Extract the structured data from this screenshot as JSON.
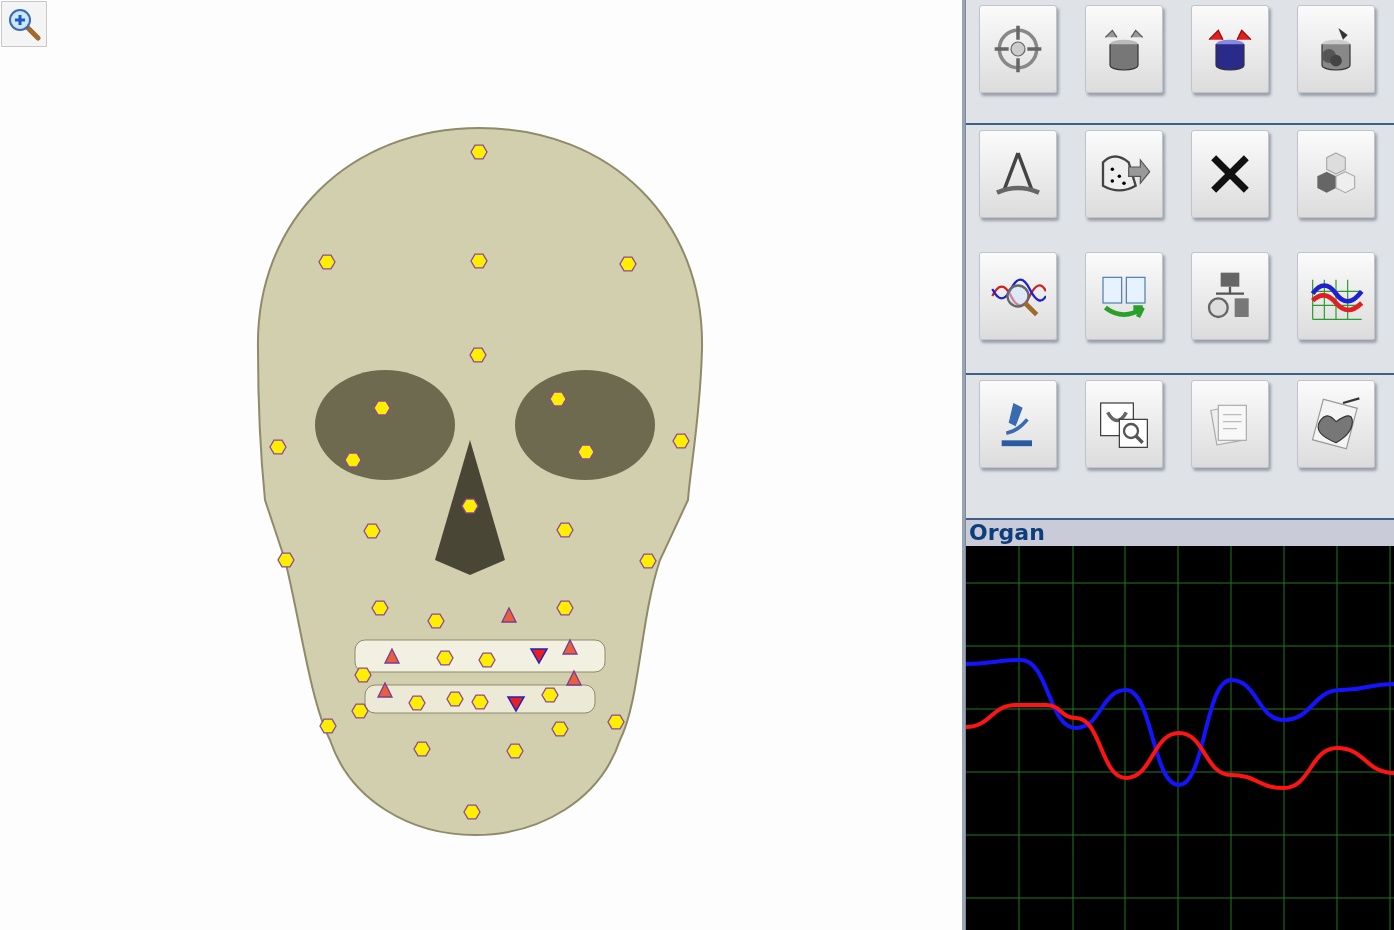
{
  "organ_panel": {
    "title": "Organ"
  }
}
